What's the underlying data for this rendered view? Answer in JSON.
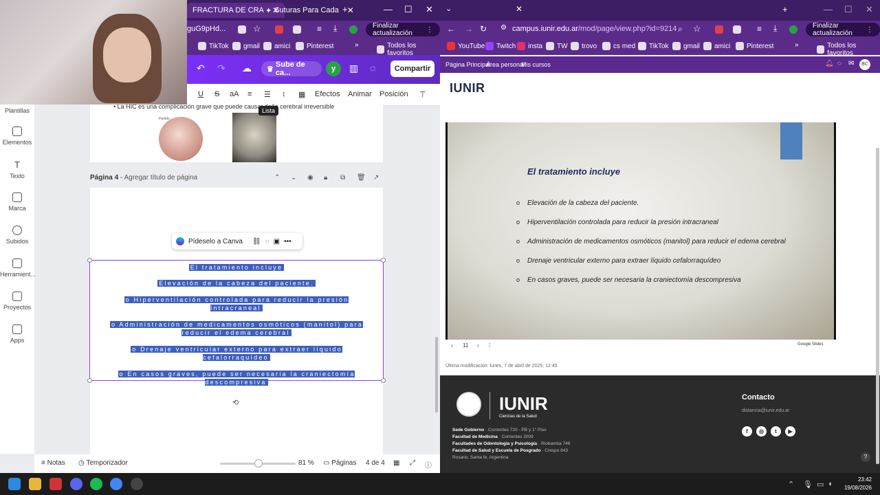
{
  "left_window": {
    "tabs": [
      {
        "label": "FRACTURA DE CRA",
        "active": true
      },
      {
        "label": "Suturas Para Cada",
        "active": false
      }
    ],
    "address_fragment": "guG9pHd...",
    "update_button": "Finalizar actualización",
    "bookmarks": [
      "TikTok",
      "gmail",
      "amici",
      "Pinterest",
      "Todos los favoritos"
    ],
    "canva": {
      "upload_pill": "Sube de ca...",
      "avatar_letter": "y",
      "share_button": "Compartir",
      "toolbar": {
        "effects": "Efectos",
        "animate": "Animar",
        "position": "Posición"
      },
      "tooltip": "Lista",
      "sidebar": [
        "Plantillas",
        "Elementos",
        "Texto",
        "Marca",
        "Subidos",
        "Herramient...",
        "Proyectos",
        "Apps"
      ],
      "page3_bullet": "La HIC es una complicación grave que puede causar daño cerebral irreversible",
      "skull_label": "Parieto",
      "page4_label": "Página 4",
      "page4_placeholder": "Agregar título de página",
      "ask_canva": "Pídeselo a Canva",
      "selected_lines": [
        "El tratamiento incluye",
        "Elevación de la cabeza del paciente.",
        "o Hiperventilación controlada para reducir la presión intracraneal",
        "o Administración de medicamentos osmóticos (manitol) para reducir el edema cerebral",
        "o Drenaje ventricular externo para extraer líquido cefalorraquídeo",
        "o En casos graves, puede ser necesaria la craniectomía descompresiva"
      ],
      "bottom": {
        "notes": "Notas",
        "timer": "Temporizador",
        "zoom": "81 %",
        "pages": "Páginas",
        "page_count": "4 de 4"
      }
    }
  },
  "right_window": {
    "url_host": "campus.iunir.edu.ar",
    "url_path": "/mod/page/view.php?id=9214",
    "update_button": "Finalizar actualización",
    "bookmarks": [
      "YouTube",
      "Twitch",
      "insta",
      "TW",
      "trovo",
      "cs med",
      "TikTok",
      "gmail",
      "amici",
      "Pinterest",
      "Todos los favoritos"
    ],
    "site_nav": [
      "Página Principal",
      "Área personal",
      "Mis cursos"
    ],
    "user_initials": "BC",
    "logo": "IUNIR",
    "slide": {
      "title": "El tratamiento incluye",
      "items": [
        "Elevación de la cabeza del paciente.",
        "Hiperventilación controlada para reducir la presión intracraneal",
        "Administración de medicamentos osmóticos (manitol) para reducir el edema cerebral",
        "Drenaje ventricular externo para extraer líquido cefalorraquídeo",
        "En casos graves, puede ser necesaria la craniectomía descompresiva"
      ],
      "page_number": "11",
      "provider": "Google Slides"
    },
    "last_modified": "Última modificación: lunes, 7 de abril de 2025, 12:45",
    "footer": {
      "brand": "IUNIR",
      "brand_sub": "Ciencias de la Salud",
      "addresses": [
        {
          "name": "Sede Gobierno",
          "addr": "Corrientes 720 - PB y 1° Piso"
        },
        {
          "name": "Facultad de Medicina",
          "addr": "Corrientes 2009"
        },
        {
          "name": "Facultades de Odontología y Psicología",
          "addr": "Riobamba 746"
        },
        {
          "name": "Facultad de Salud y Escuela de Posgrado",
          "addr": "Crespo 843"
        },
        {
          "name": "",
          "addr": "Rosario, Santa fe, Argentina"
        }
      ],
      "contact_title": "Contacto",
      "contact_email": "distancia@iunir.edu.ar"
    }
  },
  "taskbar": {
    "time": "23:42",
    "date": "19/08/2026"
  },
  "colors": {
    "browser_purple": "#5b2b8a",
    "canva_selection": "#8b3dff",
    "footer_bg": "#2b2b2b"
  }
}
